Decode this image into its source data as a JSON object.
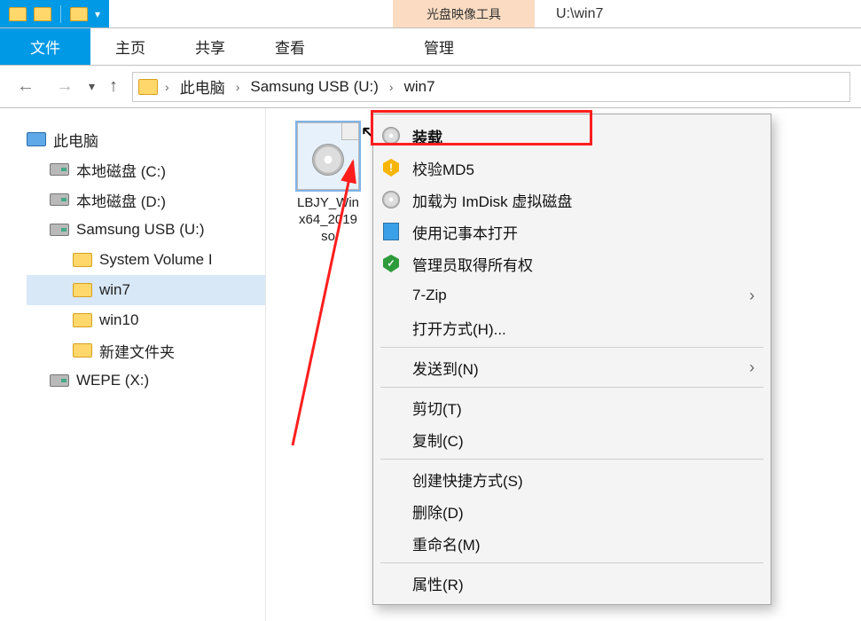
{
  "window": {
    "context_tab": "光盘映像工具",
    "title": "U:\\win7"
  },
  "ribbon": {
    "file": "文件",
    "home": "主页",
    "share": "共享",
    "view": "查看",
    "manage": "管理"
  },
  "breadcrumb": {
    "items": [
      "此电脑",
      "Samsung USB (U:)",
      "win7"
    ]
  },
  "tree": {
    "root": "此电脑",
    "drives": [
      {
        "label": "本地磁盘 (C:)",
        "type": "hd"
      },
      {
        "label": "本地磁盘 (D:)",
        "type": "hd"
      },
      {
        "label": "Samsung USB (U:)",
        "type": "hd",
        "expanded": true,
        "children": [
          {
            "label": "System Volume I",
            "type": "fd"
          },
          {
            "label": "win7",
            "type": "fd",
            "selected": true
          },
          {
            "label": "win10",
            "type": "fd"
          },
          {
            "label": "新建文件夹",
            "type": "fd"
          }
        ]
      },
      {
        "label": "WEPE (X:)",
        "type": "hd"
      }
    ]
  },
  "content": {
    "file": {
      "name_line1": "LBJY_Win",
      "name_line2": "x64_2019",
      "name_line3": "so"
    }
  },
  "context_menu": {
    "mount": "装载",
    "verify_md5": "校验MD5",
    "imdisk": "加载为 ImDisk 虚拟磁盘",
    "notepad": "使用记事本打开",
    "take_ownership": "管理员取得所有权",
    "seven_zip": "7-Zip",
    "open_with": "打开方式(H)...",
    "send_to": "发送到(N)",
    "cut": "剪切(T)",
    "copy": "复制(C)",
    "create_shortcut": "创建快捷方式(S)",
    "delete": "删除(D)",
    "rename": "重命名(M)",
    "properties": "属性(R)"
  }
}
